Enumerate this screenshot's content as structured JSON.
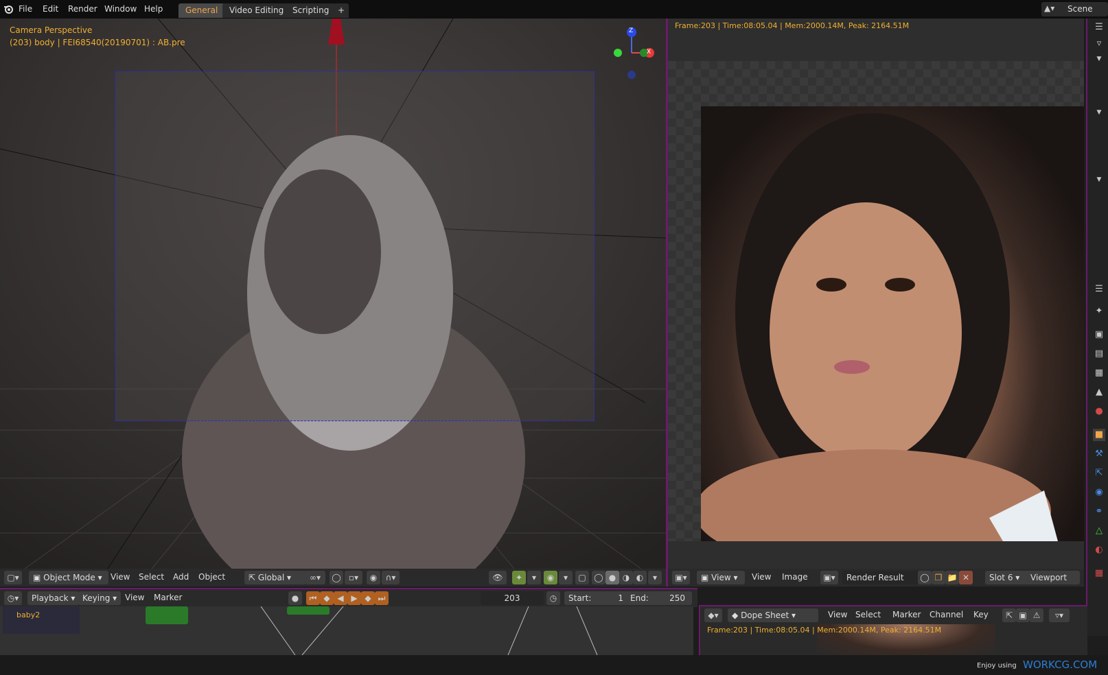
{
  "topbar": {
    "menus": [
      "File",
      "Edit",
      "Render",
      "Window",
      "Help"
    ],
    "tabs": [
      "General",
      "Video Editing",
      "Scripting"
    ],
    "add_tab": "+",
    "scene": "Scene"
  },
  "viewport": {
    "overlay_title": "Camera Perspective",
    "overlay_info": "(203) body | FEI68540(20190701) : AB.pre",
    "gizmo": {
      "z": "Z",
      "x": "X"
    },
    "header": {
      "mode": "Object Mode",
      "menus": [
        "View",
        "Select",
        "Add",
        "Object"
      ],
      "orientation": "Global"
    }
  },
  "render": {
    "stats": "Frame:203 | Time:08:05.04 | Mem:2000.14M, Peak: 2164.51M",
    "header": {
      "view_dd": "View",
      "menus": [
        "View",
        "Image"
      ],
      "image_name": "Render Result",
      "slot": "Slot 6",
      "viewport": "Viewport"
    }
  },
  "timeline": {
    "playback": "Playback",
    "keying": "Keying",
    "menus": [
      "View",
      "Marker"
    ],
    "frame": "203",
    "start_label": "Start:",
    "start": "1",
    "end_label": "End:",
    "end": "250"
  },
  "node_editor": {
    "label": "baby2"
  },
  "dopesheet": {
    "mode": "Dope Sheet",
    "menus": [
      "View",
      "Select",
      "Marker",
      "Channel",
      "Key"
    ],
    "stats": "Frame:203 | Time:08:05.04 | Mem:2000.14M, Peak: 2164.51M"
  },
  "status": {
    "prefix": "Enjoy using",
    "brand": "WORKCG.COM"
  },
  "colors": {
    "accent": "#f0a64a",
    "overlay": "#f0b030",
    "frame_border": "#6b1a6b",
    "brand": "#2a7fd4"
  }
}
